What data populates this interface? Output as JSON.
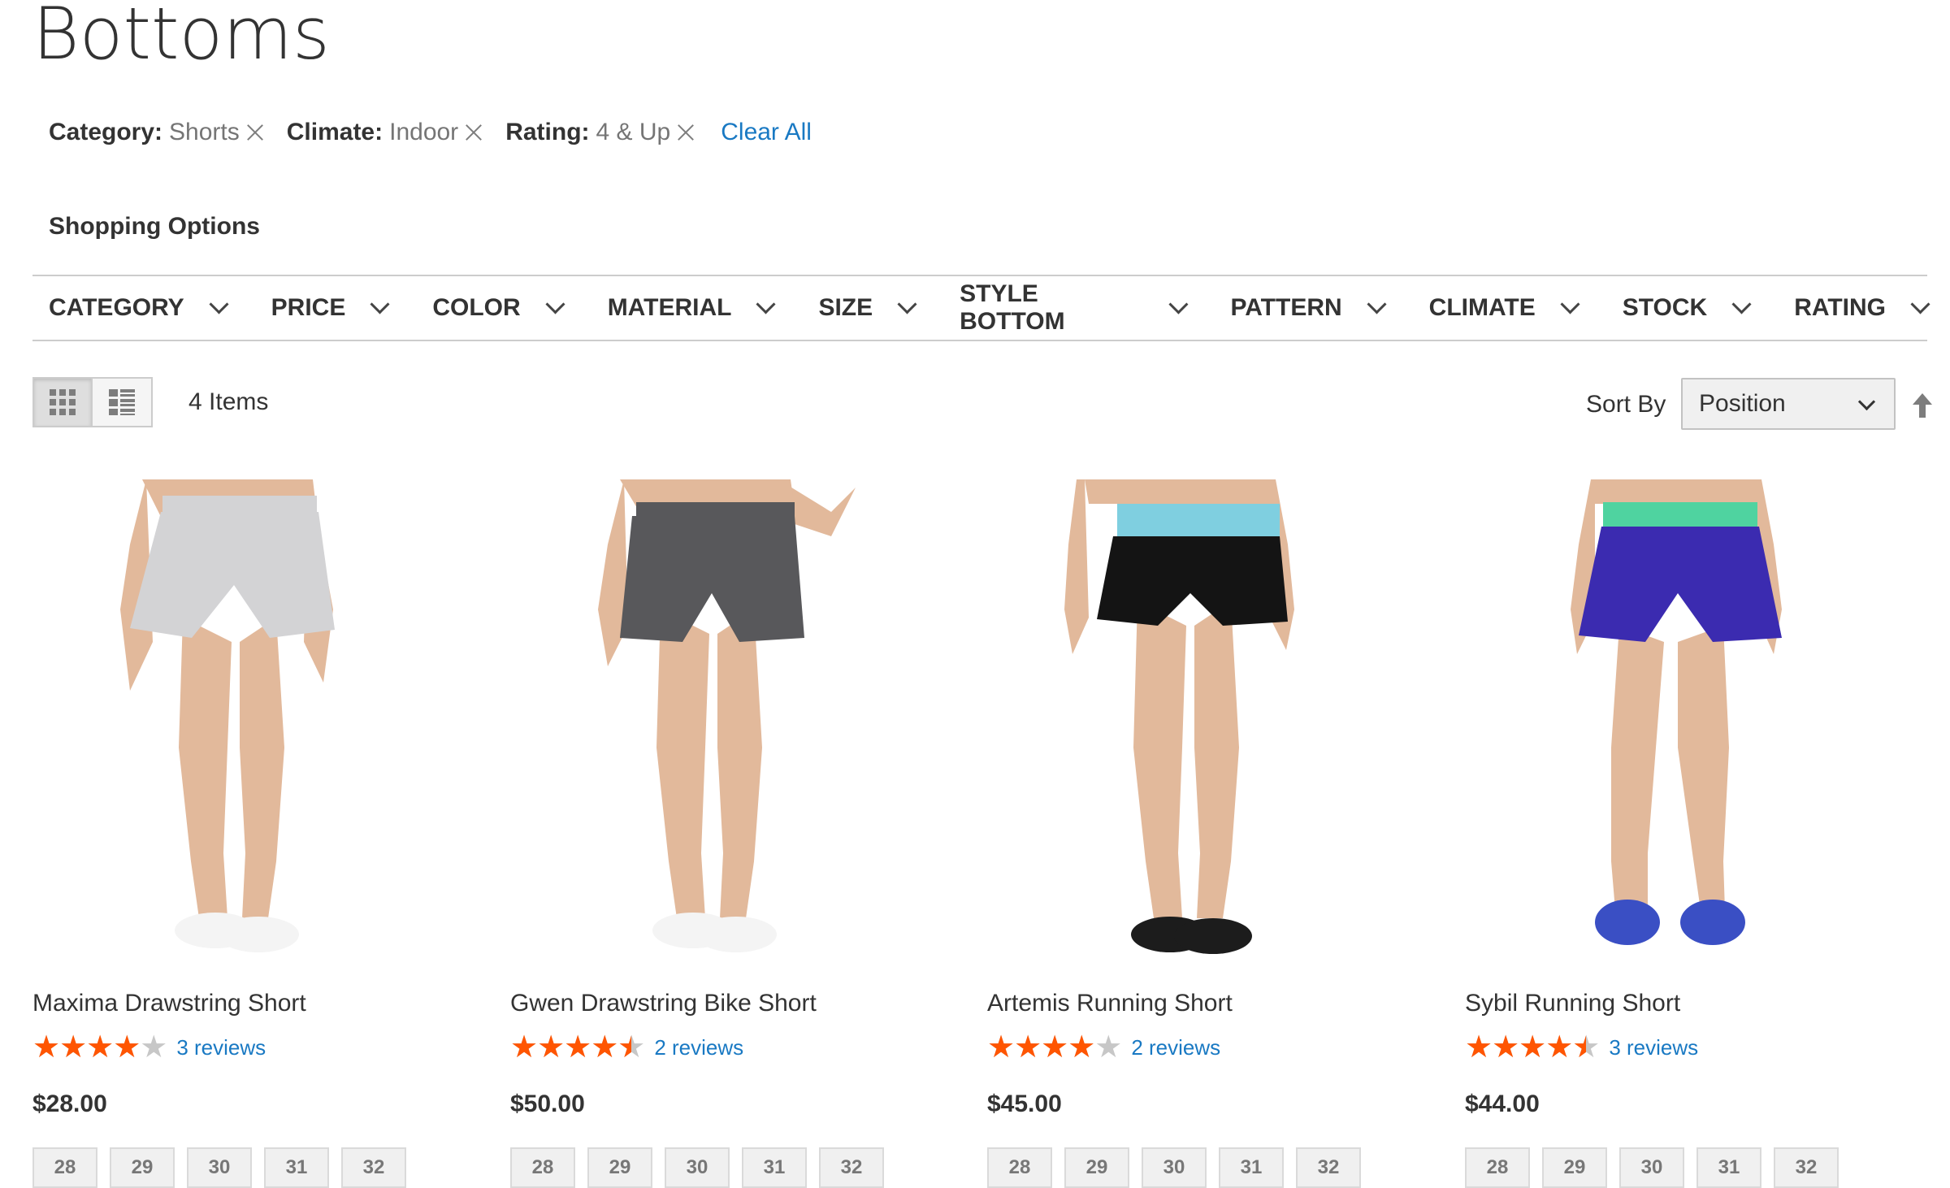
{
  "page": {
    "title": "Bottoms"
  },
  "active_filters": [
    {
      "label": "Category:",
      "value": "Shorts"
    },
    {
      "label": "Climate:",
      "value": "Indoor"
    },
    {
      "label": "Rating:",
      "value": "4 & Up"
    }
  ],
  "clear_all": "Clear All",
  "shopping_options": "Shopping Options",
  "filter_tabs": [
    "Category",
    "Price",
    "Color",
    "Material",
    "Size",
    "Style Bottom",
    "Pattern",
    "Climate",
    "Stock",
    "Rating"
  ],
  "toolbar": {
    "view_modes": [
      "grid-icon",
      "list-icon"
    ],
    "active_mode": "grid",
    "amount": "4 Items",
    "sort_label": "Sort By",
    "sort_value": "Position",
    "sort_direction_icon": "arrow-up-icon"
  },
  "colors": {
    "accent_link": "#1979c3",
    "star": "#ff5501",
    "star_empty": "#c7c7c7"
  },
  "products": [
    {
      "name": "Maxima Drawstring Short",
      "rating_percent": 80,
      "reviews": "3 reviews",
      "price": "$28.00",
      "sizes": [
        "28",
        "29",
        "30",
        "31",
        "32"
      ],
      "short_color": "#d3d3d5",
      "band_color": "#d3d3d5",
      "shoe_color": "#f4f4f4",
      "image": "product-photo"
    },
    {
      "name": "Gwen Drawstring Bike Short",
      "rating_percent": 90,
      "reviews": "2 reviews",
      "price": "$50.00",
      "sizes": [
        "28",
        "29",
        "30",
        "31",
        "32"
      ],
      "short_color": "#58585b",
      "band_color": "#58585b",
      "shoe_color": "#f4f4f4",
      "image": "product-photo"
    },
    {
      "name": "Artemis Running Short",
      "rating_percent": 80,
      "reviews": "2 reviews",
      "price": "$45.00",
      "sizes": [
        "28",
        "29",
        "30",
        "31",
        "32"
      ],
      "short_color": "#141414",
      "band_color": "#7fcfe0",
      "shoe_color": "#1c1c1c",
      "image": "product-photo"
    },
    {
      "name": "Sybil Running Short",
      "rating_percent": 90,
      "reviews": "3 reviews",
      "price": "$44.00",
      "sizes": [
        "28",
        "29",
        "30",
        "31",
        "32"
      ],
      "short_color": "#3b2bb0",
      "band_color": "#4fd3a0",
      "shoe_color": "#3a4fc4",
      "image": "product-photo"
    }
  ]
}
